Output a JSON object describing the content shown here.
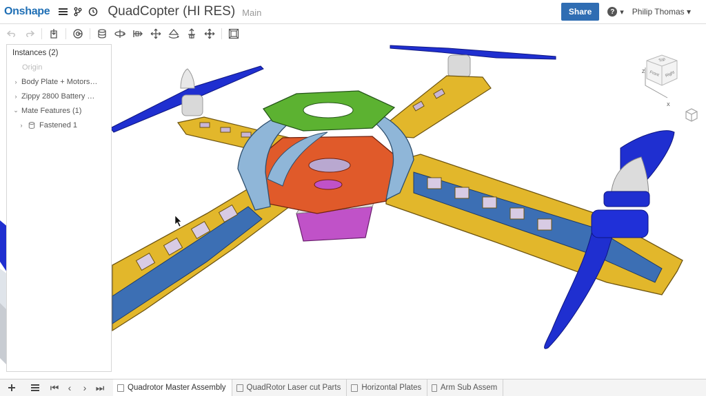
{
  "header": {
    "logo": "Onshape",
    "document_title": "QuadCopter (HI RES)",
    "workspace": "Main",
    "share_label": "Share",
    "help_label": "?",
    "user_name": "Philip Thomas"
  },
  "toolbar": {
    "icons": [
      "undo-icon",
      "redo-icon",
      "insert-icon",
      "mate-connector-icon",
      "fastened-mate-icon",
      "revolute-mate-icon",
      "slider-mate-icon",
      "planar-mate-icon",
      "cylindrical-mate-icon",
      "pin-slot-mate-icon",
      "ball-mate-icon",
      "explode-icon"
    ]
  },
  "instances": {
    "title": "Instances (2)",
    "origin": "Origin",
    "items": [
      {
        "label": "Body Plate + Motors…"
      },
      {
        "label": "Zippy 2800 Battery …"
      },
      {
        "label": "Mate Features (1)"
      },
      {
        "label": "Fastened 1"
      }
    ]
  },
  "view_cube": {
    "top": "Top",
    "front": "Front",
    "right": "Right",
    "axis_z": "Z",
    "axis_x": "X"
  },
  "colors": {
    "frame_yellow": "#e2b72b",
    "propeller_blue": "#1f2fd0",
    "top_plate_green": "#5cb231",
    "center_plate_red": "#e05a2a",
    "bracket_blue": "#8fb6d8",
    "battery_purple": "#c052c8",
    "accent_blue": "#2f6db3"
  },
  "bottom_tabs": [
    {
      "label": "Quadrotor Master Assembly",
      "active": true
    },
    {
      "label": "QuadRotor Laser cut Parts",
      "active": false
    },
    {
      "label": "Horizontal Plates",
      "active": false
    },
    {
      "label": "Arm Sub Assem",
      "active": false
    }
  ]
}
